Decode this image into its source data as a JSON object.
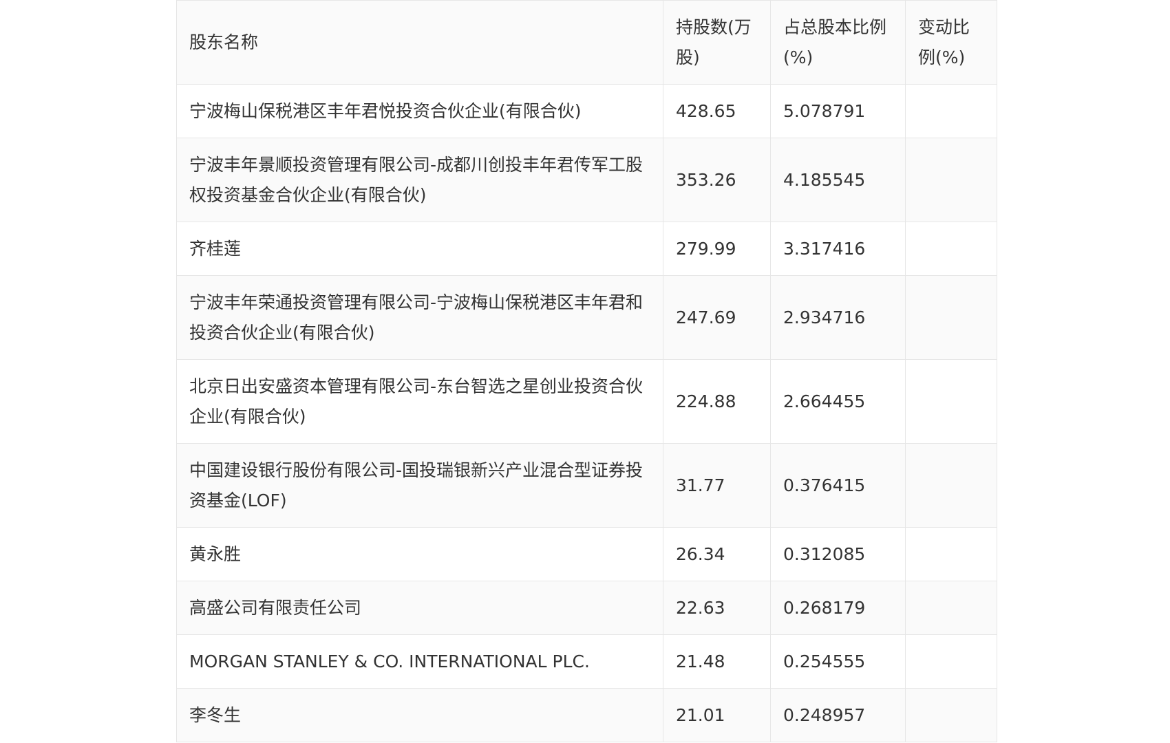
{
  "table": {
    "headers": [
      "股东名称",
      "持股数(万股)",
      "占总股本比例(%)",
      "变动比例(%)"
    ],
    "rows": [
      {
        "name": "宁波梅山保税港区丰年君悦投资合伙企业(有限合伙)",
        "shares": "428.65",
        "ratio": "5.078791",
        "change": ""
      },
      {
        "name": "宁波丰年景顺投资管理有限公司-成都川创投丰年君传军工股权投资基金合伙企业(有限合伙)",
        "shares": "353.26",
        "ratio": "4.185545",
        "change": ""
      },
      {
        "name": "齐桂莲",
        "shares": "279.99",
        "ratio": "3.317416",
        "change": ""
      },
      {
        "name": "宁波丰年荣通投资管理有限公司-宁波梅山保税港区丰年君和投资合伙企业(有限合伙)",
        "shares": "247.69",
        "ratio": "2.934716",
        "change": ""
      },
      {
        "name": "北京日出安盛资本管理有限公司-东台智选之星创业投资合伙企业(有限合伙)",
        "shares": "224.88",
        "ratio": "2.664455",
        "change": ""
      },
      {
        "name": "中国建设银行股份有限公司-国投瑞银新兴产业混合型证券投资基金(LOF)",
        "shares": "31.77",
        "ratio": "0.376415",
        "change": ""
      },
      {
        "name": "黄永胜",
        "shares": "26.34",
        "ratio": "0.312085",
        "change": ""
      },
      {
        "name": "高盛公司有限责任公司",
        "shares": "22.63",
        "ratio": "0.268179",
        "change": ""
      },
      {
        "name": "MORGAN STANLEY & CO. INTERNATIONAL PLC.",
        "shares": "21.48",
        "ratio": "0.254555",
        "change": ""
      },
      {
        "name": "李冬生",
        "shares": "21.01",
        "ratio": "0.248957",
        "change": ""
      }
    ]
  }
}
